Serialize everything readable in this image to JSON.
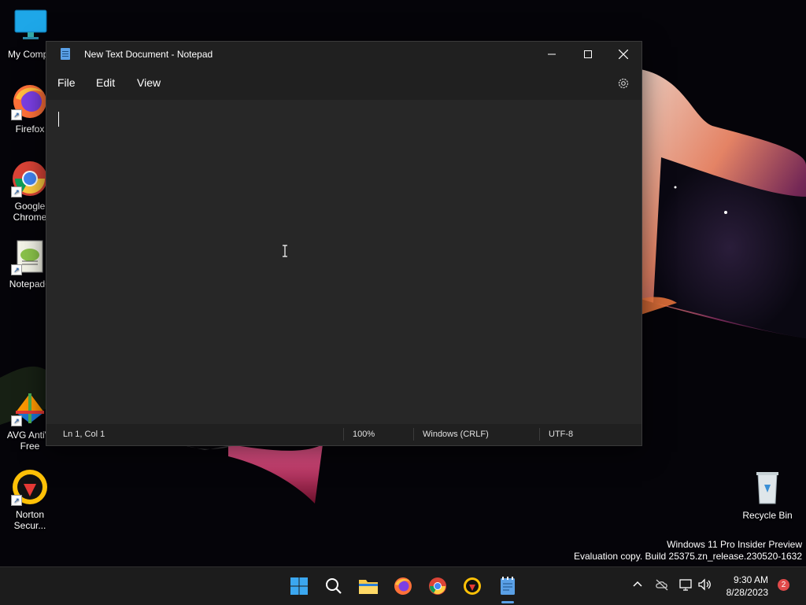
{
  "desktop": {
    "icons": [
      {
        "label": "My Compu",
        "icon": "monitor-icon"
      },
      {
        "label": "Firefox",
        "icon": "firefox-icon"
      },
      {
        "label": "Google\nChrome",
        "icon": "chrome-icon"
      },
      {
        "label": "Notepad+",
        "icon": "notepadpp-icon"
      },
      {
        "label": "AVG AntiVi\nFree",
        "icon": "avg-icon"
      },
      {
        "label": "Norton\nSecur...",
        "icon": "norton-icon"
      },
      {
        "label": "Recycle Bin",
        "icon": "recycle-bin-icon"
      }
    ],
    "watermark": {
      "line1": "Windows 11 Pro Insider Preview",
      "line2": "Evaluation copy. Build 25375.zn_release.230520-1632"
    }
  },
  "notepad": {
    "title": "New Text Document - Notepad",
    "menu": {
      "file": "File",
      "edit": "Edit",
      "view": "View"
    },
    "content": "",
    "status": {
      "position": "Ln 1, Col 1",
      "zoom": "100%",
      "line_ending": "Windows (CRLF)",
      "encoding": "UTF-8"
    }
  },
  "taskbar": {
    "apps": [
      "start-icon",
      "search-icon",
      "file-explorer-icon",
      "firefox-icon",
      "chrome-icon",
      "norton-icon",
      "notepad-icon"
    ],
    "active_app": "notepad-icon",
    "clock": {
      "time": "9:30 AM",
      "date": "8/28/2023"
    },
    "notification_count": "2"
  },
  "colors": {
    "accent": "#5aa0e6",
    "window_bg": "#202020",
    "editor_bg": "#272727"
  }
}
